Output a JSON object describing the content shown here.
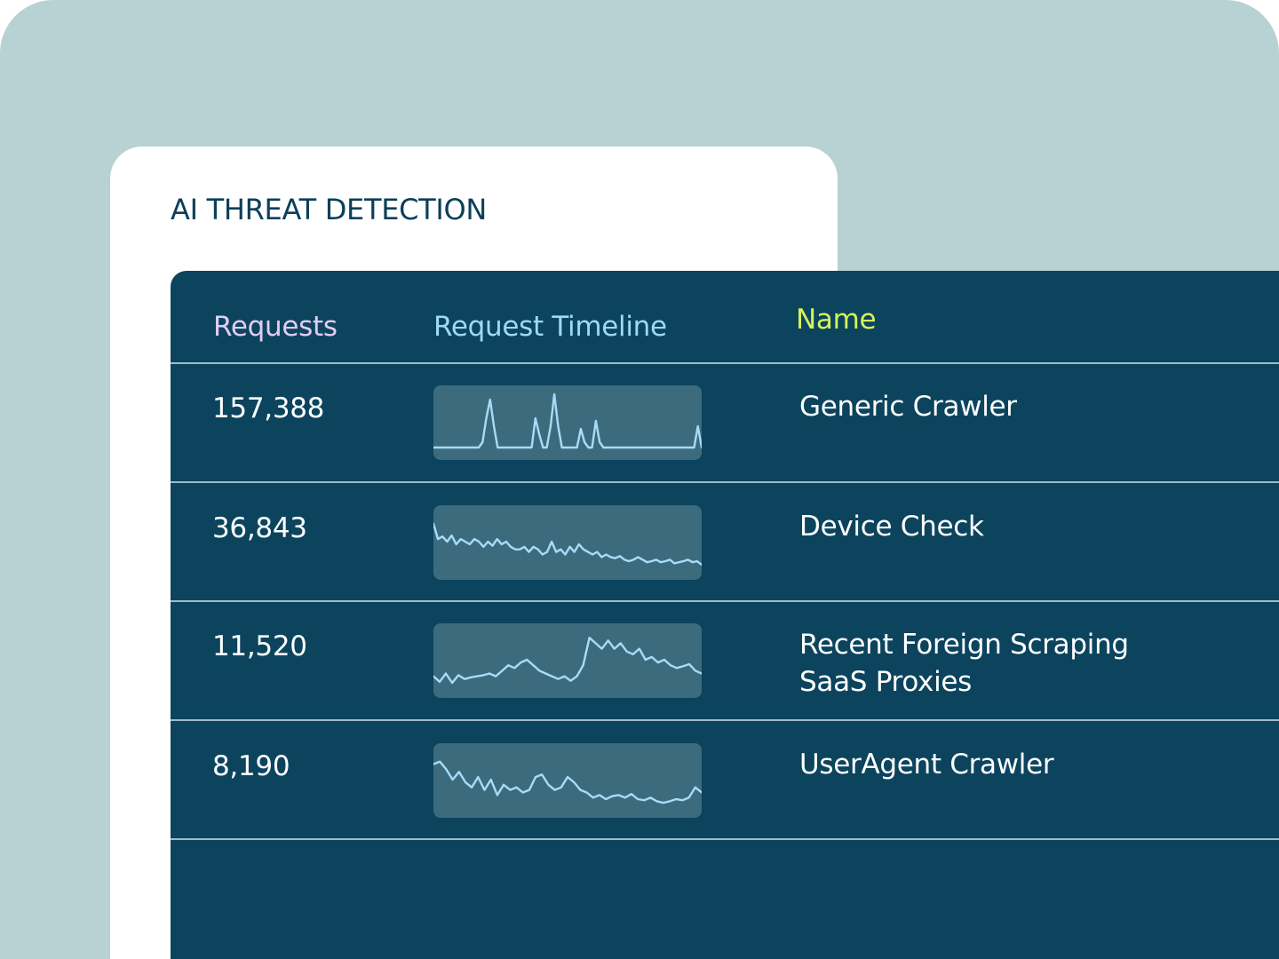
{
  "card": {
    "title": "AI THREAT DETECTION"
  },
  "table": {
    "headers": {
      "requests": "Requests",
      "timeline": "Request Timeline",
      "name": "Name"
    },
    "rows": [
      {
        "requests": "157,388",
        "name_lines": [
          "Generic Crawler",
          ""
        ],
        "timeline": [
          0,
          0,
          0,
          0,
          0,
          0,
          0,
          0,
          0,
          0,
          0,
          0,
          0,
          0.1,
          0.55,
          0.9,
          0.4,
          0,
          0,
          0,
          0,
          0,
          0,
          0,
          0,
          0,
          0,
          0.55,
          0.25,
          0,
          0,
          0.4,
          1,
          0.4,
          0,
          0,
          0,
          0,
          0,
          0.35,
          0.1,
          0,
          0,
          0.5,
          0.1,
          0,
          0,
          0,
          0,
          0,
          0,
          0,
          0,
          0,
          0,
          0,
          0,
          0,
          0,
          0,
          0,
          0,
          0,
          0,
          0,
          0,
          0,
          0,
          0,
          0,
          0.4,
          0
        ]
      },
      {
        "requests": "36,843",
        "name_lines": [
          "Device Check",
          ""
        ],
        "timeline": [
          0.85,
          0.55,
          0.6,
          0.5,
          0.62,
          0.45,
          0.55,
          0.5,
          0.45,
          0.55,
          0.5,
          0.4,
          0.5,
          0.42,
          0.55,
          0.45,
          0.5,
          0.4,
          0.35,
          0.35,
          0.4,
          0.3,
          0.4,
          0.35,
          0.25,
          0.3,
          0.5,
          0.3,
          0.35,
          0.25,
          0.4,
          0.3,
          0.45,
          0.35,
          0.3,
          0.25,
          0.3,
          0.2,
          0.25,
          0.2,
          0.18,
          0.22,
          0.15,
          0.12,
          0.15,
          0.2,
          0.15,
          0.1,
          0.12,
          0.15,
          0.1,
          0.12,
          0.15,
          0.08,
          0.1,
          0.12,
          0.15,
          0.1,
          0.12,
          0.05
        ]
      },
      {
        "requests": "11,520",
        "name_lines": [
          "Recent Foreign Scraping",
          "SaaS Proxies"
        ],
        "timeline": [
          0.2,
          0.1,
          0.25,
          0.08,
          0.22,
          0.15,
          0.18,
          0.2,
          0.22,
          0.25,
          0.2,
          0.3,
          0.4,
          0.35,
          0.45,
          0.5,
          0.4,
          0.3,
          0.25,
          0.2,
          0.15,
          0.2,
          0.12,
          0.2,
          0.4,
          0.9,
          0.8,
          0.7,
          0.85,
          0.7,
          0.8,
          0.65,
          0.6,
          0.7,
          0.5,
          0.55,
          0.45,
          0.5,
          0.4,
          0.35,
          0.38,
          0.42,
          0.3,
          0.25
        ]
      },
      {
        "requests": "8,190",
        "name_lines": [
          "UserAgent Crawler",
          ""
        ],
        "timeline": [
          0.8,
          0.85,
          0.7,
          0.5,
          0.65,
          0.45,
          0.35,
          0.55,
          0.3,
          0.5,
          0.2,
          0.4,
          0.3,
          0.35,
          0.25,
          0.3,
          0.55,
          0.6,
          0.4,
          0.3,
          0.35,
          0.55,
          0.45,
          0.3,
          0.25,
          0.15,
          0.2,
          0.12,
          0.18,
          0.2,
          0.15,
          0.22,
          0.12,
          0.1,
          0.15,
          0.08,
          0.05,
          0.08,
          0.12,
          0.1,
          0.15,
          0.35,
          0.25
        ]
      }
    ]
  },
  "colors": {
    "backdrop": "#b8d1d3",
    "card": "#ffffff",
    "title": "#0b3f5a",
    "panel": "#0c445e",
    "divider": "#9fbcc6",
    "header_requests": "#e2ccf2",
    "header_timeline": "#9ed9f5",
    "header_name": "#d4f35c",
    "sparkline_bg": "#3c6b7e",
    "sparkline_line": "#a6dcf7",
    "cell_text": "#ffffff"
  }
}
